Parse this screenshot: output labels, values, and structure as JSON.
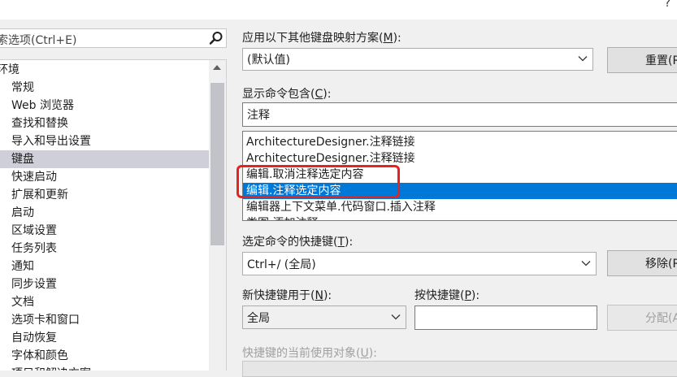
{
  "help": {
    "icon": "question-mark",
    "label": "?"
  },
  "search": {
    "text": "搜索选项(Ctrl+E)",
    "icon": "search-icon"
  },
  "tree": {
    "items": [
      {
        "label": "环境",
        "root": true
      },
      {
        "label": "常规"
      },
      {
        "label": "Web 浏览器"
      },
      {
        "label": "查找和替换"
      },
      {
        "label": "导入和导出设置"
      },
      {
        "label": "键盘",
        "selected": true
      },
      {
        "label": "快速启动"
      },
      {
        "label": "扩展和更新"
      },
      {
        "label": "启动"
      },
      {
        "label": "区域设置"
      },
      {
        "label": "任务列表"
      },
      {
        "label": "通知"
      },
      {
        "label": "同步设置"
      },
      {
        "label": "文档"
      },
      {
        "label": "选项卡和窗口"
      },
      {
        "label": "自动恢复"
      },
      {
        "label": "字体和颜色"
      },
      {
        "label": "项目和解决方案"
      }
    ]
  },
  "mapping": {
    "label": "应用以下其他键盘映射方案(",
    "mnemonic": "M",
    "label_suffix": "):",
    "value": "(默认值)",
    "reset_button": "重置(R)"
  },
  "filter": {
    "label": "显示命令包含(",
    "mnemonic": "C",
    "label_suffix": "):",
    "value": "注释"
  },
  "commands": {
    "items": [
      {
        "label": "ArchitectureDesigner.注释链接"
      },
      {
        "label": "ArchitectureDesigner.注释链接"
      },
      {
        "label": "编辑.取消注释选定内容"
      },
      {
        "label": "编辑.注释选定内容",
        "selected": true
      },
      {
        "label": "编辑器上下文菜单.代码窗口.插入注释"
      },
      {
        "label": "类图.添加注释"
      }
    ]
  },
  "shortcuts": {
    "label": "选定命令的快捷键(",
    "mnemonic": "T",
    "label_suffix": "):",
    "value": "Ctrl+/ (全局)",
    "remove_button": "移除(R)"
  },
  "new_shortcut": {
    "scope_label": "新快捷键用于(",
    "scope_mnemonic": "N",
    "scope_label_suffix": "):",
    "scope_value": "全局",
    "press_label": "按快捷键(",
    "press_mnemonic": "P",
    "press_label_suffix": "):",
    "press_value": "",
    "assign_button": "分配(A)"
  },
  "usage": {
    "label": "快捷键的当前使用对象(",
    "mnemonic": "U",
    "label_suffix": "):"
  },
  "colors": {
    "selection": "#0078d7",
    "tree_selection": "#cfcfd9",
    "annotation_box": "#e8231f"
  }
}
